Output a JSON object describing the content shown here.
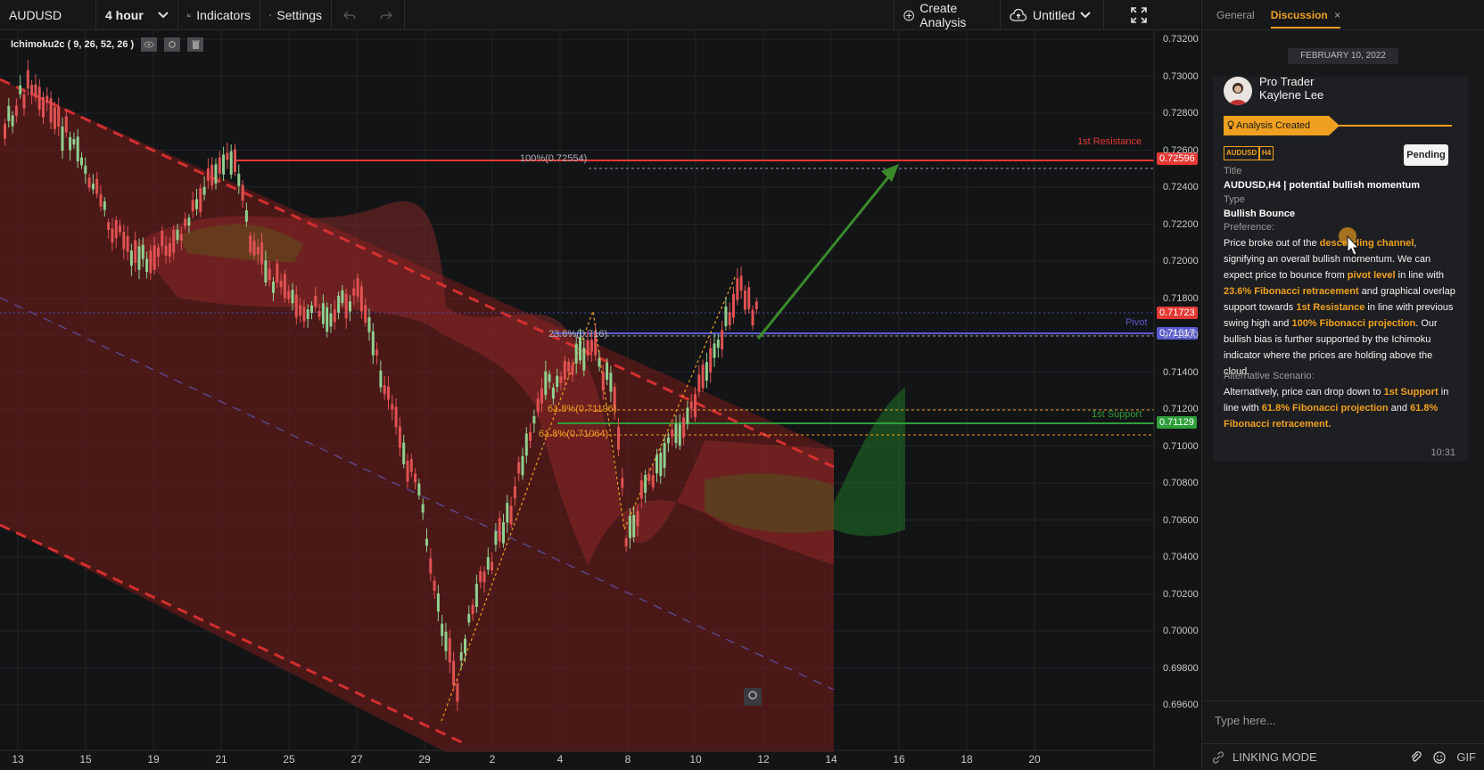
{
  "toolbar": {
    "symbol": "AUDUSD",
    "interval": "4 hour",
    "indicators_label": "Indicators",
    "settings_label": "Settings",
    "create_analysis_label": "Create Analysis",
    "untitled_label": "Untitled"
  },
  "indicator_legend": "Ichimoku2c ( 9, 26, 52, 26 )",
  "price_axis": [
    "0.73200",
    "0.73000",
    "0.72800",
    "0.72600",
    "0.72400",
    "0.72200",
    "0.72000",
    "0.71800",
    "0.71600",
    "0.71400",
    "0.71200",
    "0.71000",
    "0.70800",
    "0.70600",
    "0.70400",
    "0.70200",
    "0.70000",
    "0.69800",
    "0.69600"
  ],
  "date_axis": [
    "13",
    "15",
    "19",
    "21",
    "25",
    "27",
    "29",
    "2",
    "4",
    "8",
    "10",
    "12",
    "14",
    "16",
    "18",
    "20"
  ],
  "price_tags": {
    "resistance": "0.72596",
    "current": "0.71723",
    "pivot": "0.71617",
    "support": "0.71129"
  },
  "annotations": {
    "resistance_label": "1st Resistance",
    "pivot_label": "Pivot",
    "support_label": "1st Support",
    "fib_100": "100%(0.72554)",
    "fib_236": "23.6%(0.716)",
    "fib_618_a": "61.8%(0.71196)",
    "fib_618_b": "61.8%(0.71064)"
  },
  "colors": {
    "resistance": "#e53935",
    "pivot": "#5050c8",
    "support": "#2e9e3a",
    "fib": "#f0a020",
    "accent": "#f0a020"
  },
  "panel": {
    "tab_general": "General",
    "tab_discussion": "Discussion",
    "tab_close": "×",
    "date": "FEBRUARY 10, 2022",
    "user_role": "Pro Trader",
    "user_name": "Kaylene Lee",
    "status": "Analysis Created",
    "chip_symbol": "AUDUSD",
    "chip_tf": "H4",
    "pending": "Pending",
    "title_label": "Title",
    "title_value": "AUDUSD,H4 | potential bullish momentum",
    "type_label": "Type",
    "type_value": "Bullish Bounce",
    "preference_label": "Preference:",
    "pref": {
      "t1": "Price broke out of the ",
      "h1": "descending channel",
      "t2": ", signifying an overall bullish momentum. We can expect price to bounce from ",
      "h2": "pivot level",
      "t3": " in line with ",
      "h3": "23.6% Fibonacci retracement",
      "t4": " and graphical overlap support towards ",
      "h4": "1st Resistance",
      "t5": "  in line with previous swing high and ",
      "h5": "100% Fibonacci projection",
      "t6": ". Our bullish bias is further supported by the Ichimoku indicator where the prices are holding above the cloud."
    },
    "alt_label": "Alternative Scenario:",
    "alt": {
      "t1": "Alternatively, price can drop down to ",
      "h1": "1st Support",
      "t2": " in line with ",
      "h2": "61.8% Fibonacci projection",
      "t3": " and ",
      "h3": "61.8% Fibonacci retracement."
    },
    "time": "10:31",
    "placeholder": "Type here...",
    "linking_mode": "LINKING MODE",
    "gif": "GIF"
  }
}
